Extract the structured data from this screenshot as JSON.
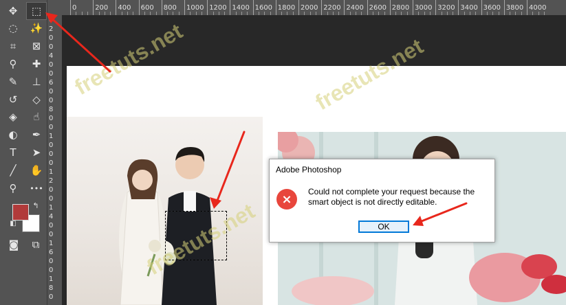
{
  "ruler": {
    "top_labels": [
      "0",
      "200",
      "400",
      "600",
      "800",
      "1000",
      "1200",
      "1400",
      "1600",
      "1800",
      "2000",
      "2200",
      "2400",
      "2600",
      "2800",
      "3000",
      "3200",
      "3400",
      "3600",
      "3800",
      "4000"
    ],
    "left_labels": [
      "0",
      "2",
      "0",
      "0",
      "4",
      "0",
      "0",
      "6",
      "0",
      "0",
      "8",
      "0",
      "0",
      "1",
      "0",
      "0",
      "0",
      "1",
      "2",
      "0",
      "0",
      "1",
      "4",
      "0",
      "0",
      "1",
      "6",
      "0",
      "0",
      "1",
      "8",
      "0"
    ]
  },
  "toolbar": {
    "tools": [
      {
        "name": "move-tool",
        "glyph": "✥"
      },
      {
        "name": "rectangular-marquee-tool",
        "glyph": "⬚",
        "selected": true
      },
      {
        "name": "lasso-tool",
        "glyph": "◌"
      },
      {
        "name": "magic-wand-tool",
        "glyph": "✨"
      },
      {
        "name": "crop-tool",
        "glyph": "⌗"
      },
      {
        "name": "frame-tool",
        "glyph": "⊠"
      },
      {
        "name": "eyedropper-tool",
        "glyph": "⚲"
      },
      {
        "name": "healing-brush-tool",
        "glyph": "✚"
      },
      {
        "name": "brush-tool",
        "glyph": "✎"
      },
      {
        "name": "clone-stamp-tool",
        "glyph": "⊥"
      },
      {
        "name": "history-brush-tool",
        "glyph": "↺"
      },
      {
        "name": "eraser-tool",
        "glyph": "◇"
      },
      {
        "name": "paint-bucket-tool",
        "glyph": "◈"
      },
      {
        "name": "smudge-tool",
        "glyph": "☝"
      },
      {
        "name": "dodge-tool",
        "glyph": "◐"
      },
      {
        "name": "pen-tool",
        "glyph": "✒"
      },
      {
        "name": "type-tool",
        "glyph": "T"
      },
      {
        "name": "path-selection-tool",
        "glyph": "➤"
      },
      {
        "name": "line-tool",
        "glyph": "╱"
      },
      {
        "name": "hand-tool",
        "glyph": "✋"
      },
      {
        "name": "zoom-tool",
        "glyph": "⚲"
      },
      {
        "name": "more-tools",
        "glyph": "•••"
      }
    ],
    "foreground_color": "#b13a3a",
    "background_color": "#ffffff",
    "quick_mask_glyph": "◙",
    "screen_mode_glyph": "⧉",
    "swap_glyph": "↰",
    "default_colors_glyph": "◧"
  },
  "watermark": "freetuts.net",
  "dialog": {
    "title": "Adobe Photoshop",
    "icon": "×",
    "message": "Could not complete your request because the smart object is not directly editable.",
    "ok_label": "OK"
  },
  "colors": {
    "toolbar_bg": "#535353",
    "canvas_bg": "#282828",
    "annotation_arrow": "#e8271c",
    "dialog_error": "#e8463c",
    "button_border": "#0078d7"
  }
}
